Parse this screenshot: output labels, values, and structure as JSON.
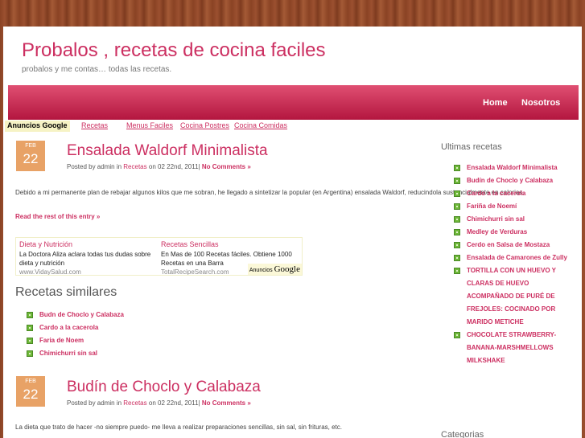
{
  "header": {
    "title": "Probalos , recetas de cocina faciles",
    "description": "probalos y me contas… todas las recetas."
  },
  "nav": {
    "items": [
      "Home",
      "Nosotros"
    ]
  },
  "ad_links": {
    "label": "Anuncios Google",
    "links": [
      "Recetas",
      "Menus Faciles",
      "Cocina Postres",
      "Cocina Comidas"
    ]
  },
  "posts": [
    {
      "month": "FEB",
      "day": "22",
      "title": "Ensalada Waldorf Minimalista",
      "meta_prefix": "Posted by admin in",
      "category": "Recetas",
      "meta_date": "on 02 22nd, 2011|",
      "comments": "No Comments »",
      "excerpt": "Debido a mi permanente plan de rebajar algunos kilos que me sobran, he llegado a sintetizar la popular (en Argentina) ensalada Waldorf, reducindola sustancialmente en calorias.",
      "read_more": "Read the rest of this entry »"
    },
    {
      "month": "FEB",
      "day": "22",
      "title": "Budín de Choclo y Calabaza",
      "meta_prefix": "Posted by admin in",
      "category": "Recetas",
      "meta_date": "on 02 22nd, 2011|",
      "comments": "No Comments »",
      "excerpt": "La dieta que trato de hacer -no siempre puedo- me lleva a realizar preparaciones sencillas, sin sal, sin frituras, etc."
    }
  ],
  "ad_box": {
    "ads": [
      {
        "title": "Dieta y Nutrición",
        "text": "La Doctora Aliza aclara todas tus dudas sobre dieta y nutrición",
        "url": "www.VidaySalud.com"
      },
      {
        "title": "Recetas Sencillas",
        "text": "En Mas de 100 Recetas fáciles. Obtiene 1000 Recetas en una Barra",
        "url": "TotalRecipeSearch.com"
      }
    ],
    "label_prefix": "Anuncios",
    "label_brand": "Google"
  },
  "similar": {
    "title": "Recetas similares",
    "items": [
      "Budn de Choclo y Calabaza",
      "Cardo a la cacerola",
      "Faria de Noem",
      "Chimichurri sin sal"
    ]
  },
  "sidebar": {
    "recent_title": "Ultimas recetas",
    "recent": [
      "Ensalada Waldorf Minimalista",
      "Budín de Choclo y Calabaza",
      "Cardo a la cacerola",
      "Fariña de Noemí",
      "Chimichurri sin sal",
      "Medley de Verduras",
      "Cerdo en Salsa de Mostaza",
      "Ensalada de Camarones de Zully",
      "TORTILLA CON UN HUEVO Y CLARAS DE HUEVO ACOMPAÑADO DE PURÉ DE FREJOLES: COCINADO POR MARIDO METICHE",
      "CHOCOLATE STRAWBERRY-BANANA-MARSHMELLOWS MILKSHAKE"
    ],
    "categories_title": "Categorias"
  },
  "colors": {
    "accent": "#cc2f61",
    "nav_top": "#e04f72",
    "nav_bottom": "#b3163f",
    "date_badge": "#e8a266",
    "bullet": "#6fb83a"
  }
}
